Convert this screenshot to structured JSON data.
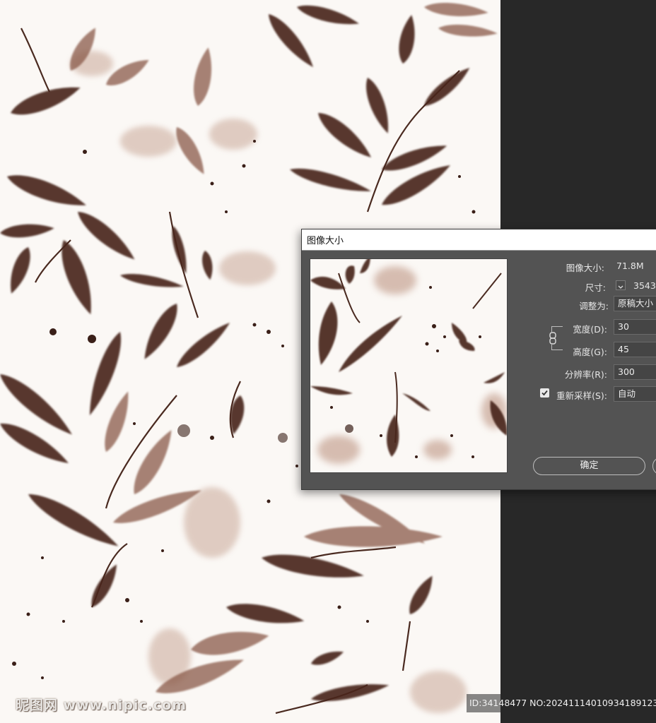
{
  "dialog": {
    "title": "图像大小",
    "image_size_label": "图像大小:",
    "image_size_value": "71.8M",
    "dimensions_label": "尺寸:",
    "dimensions_value": "3543",
    "fit_to_label": "调整为:",
    "fit_to_value": "原稿大小",
    "width_label": "宽度(D):",
    "width_value": "30",
    "height_label": "高度(G):",
    "height_value": "45",
    "resolution_label": "分辨率(R):",
    "resolution_value": "300",
    "resample_label": "重新采样(S):",
    "resample_checked": true,
    "resample_value": "自动",
    "ok_label": "确定"
  },
  "watermark": {
    "site": "昵图网 www.nipic.com",
    "id_text": "ID:34148477 NO:20241114010934189123"
  },
  "colors": {
    "leaf_dark": "#3d2018",
    "leaf_mid": "#6b4030",
    "leaf_light": "#b08878",
    "canvas_bg": "#fbf8f5",
    "dialog_bg": "#535353",
    "workspace_bg": "#282828"
  }
}
